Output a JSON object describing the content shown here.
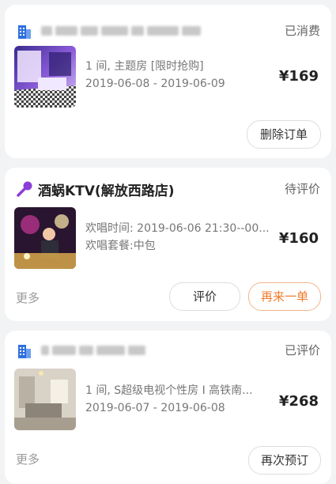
{
  "orders": [
    {
      "shop_name": "",
      "status": "已消费",
      "line1": "1 间, 主题房 [限时抢购]",
      "line2": "2019-06-08 - 2019-06-09",
      "price": "¥169",
      "buttons": [
        "删除订单"
      ]
    },
    {
      "shop_name": "酒蜗KTV(解放西路店)",
      "status": "待评价",
      "line1": "欢唱时间: 2019-06-06 21:30--00...",
      "line2": "欢唱套餐:中包",
      "price": "¥160",
      "more": "更多",
      "buttons": [
        "评价",
        "再来一单"
      ]
    },
    {
      "shop_name": "",
      "status": "已评价",
      "line1": "1 间, S超级电视个性房 I 高铁南...",
      "line2": "2019-06-07 - 2019-06-08",
      "price": "¥268",
      "more": "更多",
      "buttons": [
        "再次预订"
      ]
    }
  ],
  "colors": {
    "accent": "#f07a2a",
    "hotel_icon": "#2f6fdf",
    "ktv_icon": "#8b3fd9"
  },
  "icons": {
    "hotel": "building-icon",
    "ktv": "microphone-icon"
  }
}
